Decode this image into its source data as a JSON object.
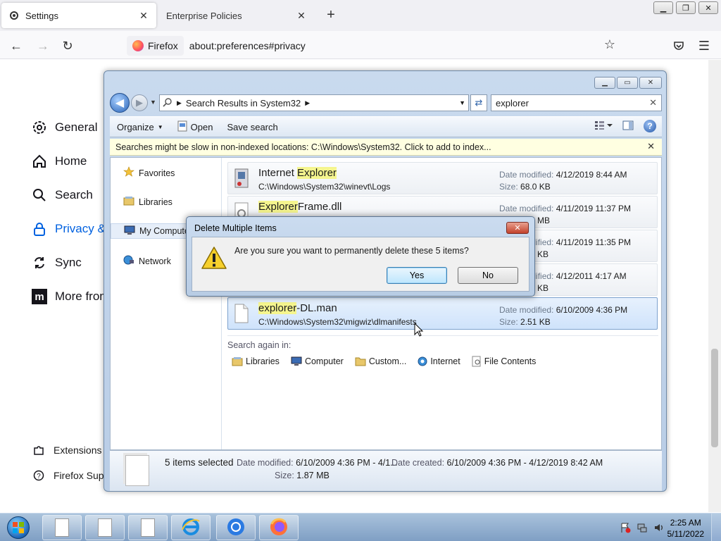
{
  "browser": {
    "tabs": [
      {
        "label": "Settings",
        "active": true
      },
      {
        "label": "Enterprise Policies",
        "active": false
      }
    ],
    "new_tab_label": "+",
    "identity_label": "Firefox",
    "url": "about:preferences#privacy"
  },
  "settings_sidebar": {
    "items": [
      {
        "label": "General",
        "icon": "gear-icon"
      },
      {
        "label": "Home",
        "icon": "home-icon"
      },
      {
        "label": "Search",
        "icon": "search-icon"
      },
      {
        "label": "Privacy &",
        "icon": "lock-icon",
        "active": true
      },
      {
        "label": "Sync",
        "icon": "sync-icon"
      },
      {
        "label": "More from",
        "icon": "mozilla-icon"
      }
    ],
    "footer": [
      {
        "label": "Extensions",
        "icon": "puzzle-icon"
      },
      {
        "label": "Firefox Supp",
        "icon": "help-icon"
      }
    ]
  },
  "explorer": {
    "breadcrumb": [
      "Search Results in System32"
    ],
    "search_value": "explorer",
    "toolbar": {
      "organize": "Organize",
      "open": "Open",
      "save_search": "Save search"
    },
    "infobar": "Searches might be slow in non-indexed locations: C:\\Windows\\System32. Click to add to index...",
    "nav": [
      {
        "label": "Favorites",
        "icon": "star-icon"
      },
      {
        "label": "Libraries",
        "icon": "libraries-icon"
      },
      {
        "label": "My Compute",
        "icon": "computer-icon",
        "selected": true
      },
      {
        "label": "Network",
        "icon": "network-icon"
      }
    ],
    "date_label": "Date modified:",
    "size_label": "Size:",
    "results": [
      {
        "name_pre": "Internet ",
        "name_hl": "Explorer",
        "name_post": "",
        "path": "C:\\Windows\\System32\\winevt\\Logs",
        "date": "4/12/2019 8:44 AM",
        "size": "68.0 KB"
      },
      {
        "name_pre": "",
        "name_hl": "Explorer",
        "name_post": "Frame.dll",
        "path": "",
        "date": "4/11/2019 11:37 PM",
        "size": "3 MB"
      },
      {
        "name_pre": "",
        "name_hl": "",
        "name_post": "",
        "path": "",
        "date": "4/11/2019 11:35 PM",
        "size": "9 KB"
      },
      {
        "name_pre": "",
        "name_hl": "",
        "name_post": "",
        "path": "",
        "date": "4/12/2011 4:17 AM",
        "size": "9 KB"
      },
      {
        "name_pre": "",
        "name_hl": "explorer",
        "name_post": "-DL.man",
        "path": "C:\\Windows\\System32\\migwiz\\dlmanifests",
        "date": "6/10/2009 4:36 PM",
        "size": "2.51 KB",
        "selected": true
      }
    ],
    "search_again_label": "Search again in:",
    "search_again": [
      "Libraries",
      "Computer",
      "Custom...",
      "Internet",
      "File Contents"
    ],
    "details": {
      "count": "5 items selected",
      "modified_label": "Date modified:",
      "modified": "6/10/2009 4:36 PM - 4/1...",
      "created_label": "Date created:",
      "created": "6/10/2009 4:36 PM - 4/12/2019 8:42 AM",
      "size_label": "Size:",
      "size": "1.87 MB"
    }
  },
  "dialog": {
    "title": "Delete Multiple Items",
    "message": "Are you sure you want to permanently delete these 5 items?",
    "yes": "Yes",
    "no": "No"
  },
  "taskbar": {
    "time": "2:25 AM",
    "date": "5/11/2022"
  }
}
